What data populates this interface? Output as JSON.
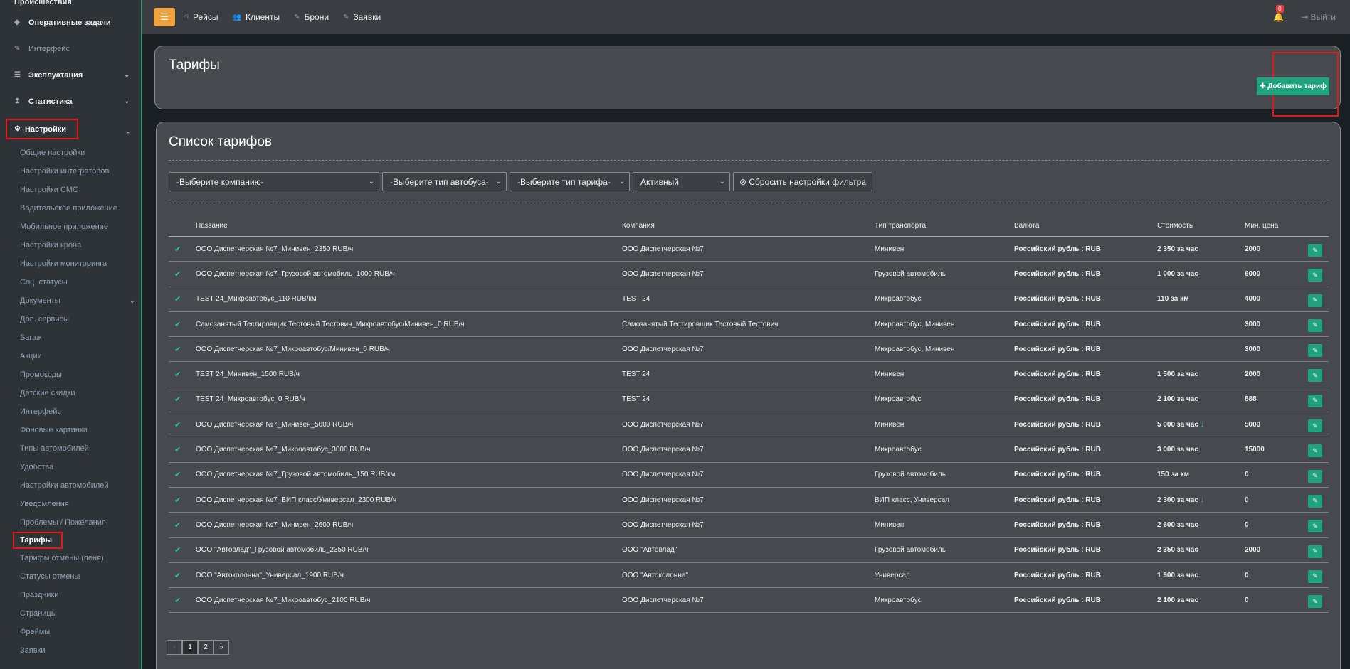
{
  "sidebar": {
    "top_item": "Происшествия",
    "items": [
      {
        "label": "Оперативные задачи"
      },
      {
        "label": "Интерфейс"
      },
      {
        "label": "Эксплуатация"
      },
      {
        "label": "Статистика"
      }
    ],
    "settings_label": "Настройки",
    "sub_items": [
      "Общие настройки",
      "Настройки интеграторов",
      "Настройки СМС",
      "Водительское приложение",
      "Мобильное приложение",
      "Настройки крона",
      "Настройки мониторинга",
      "Соц. статусы",
      "Документы",
      "Доп. сервисы",
      "Багаж",
      "Акции",
      "Промокоды",
      "Детские скидки",
      "Интерфейс",
      "Фоновые картинки",
      "Типы автомобилей",
      "Удобства",
      "Настройки автомобилей",
      "Уведомления",
      "Проблемы / Пожелания",
      "Тарифы",
      "Тарифы отмены (пеня)",
      "Статусы отмены",
      "Праздники",
      "Страницы",
      "Фреймы",
      "Заявки"
    ]
  },
  "topbar": {
    "nav": [
      "Рейсы",
      "Клиенты",
      "Брони",
      "Заявки"
    ],
    "badge": "0",
    "logout": "Выйти"
  },
  "header": {
    "title": "Тарифы",
    "add_button": "Добавить тариф"
  },
  "list": {
    "title": "Список тарифов",
    "filters": {
      "company": "-Выберите компанию-",
      "bus_type": "-Выберите тип автобуса-",
      "tariff_type": "-Выберите тип тарифа-",
      "status": "Активный",
      "reset": "Сбросить настройки фильтра"
    },
    "columns": [
      "Название",
      "Компания",
      "Тип транспорта",
      "Валюта",
      "Стоимость",
      "Мин. цена"
    ],
    "rows": [
      {
        "name": "ООО Диспетчерская №7_Минивен_2350 RUB/ч",
        "company": "ООО Диспетчерская №7",
        "transport": "Минивен",
        "currency": "Российский рубль : RUB",
        "cost": "2 350 за час",
        "min": "2000",
        "down": false
      },
      {
        "name": "ООО Диспетчерская №7_Грузовой автомобиль_1000 RUB/ч",
        "company": "ООО Диспетчерская №7",
        "transport": "Грузовой автомобиль",
        "currency": "Российский рубль : RUB",
        "cost": "1 000 за час",
        "min": "6000",
        "down": false
      },
      {
        "name": "TEST 24_Микроавтобус_110 RUB/км",
        "company": "TEST 24",
        "transport": "Микроавтобус",
        "currency": "Российский рубль : RUB",
        "cost": "110 за км",
        "min": "4000",
        "down": false
      },
      {
        "name": "Самозанятый Тестировщик Тестовый Тестович_Микроавтобус/Минивен_0 RUB/ч",
        "company": "Самозанятый Тестировщик Тестовый Тестович",
        "transport": "Микроавтобус, Минивен",
        "currency": "Российский рубль : RUB",
        "cost": "",
        "min": "3000",
        "down": false
      },
      {
        "name": "ООО Диспетчерская №7_Микроавтобус/Минивен_0 RUB/ч",
        "company": "ООО Диспетчерская №7",
        "transport": "Микроавтобус, Минивен",
        "currency": "Российский рубль : RUB",
        "cost": "",
        "min": "3000",
        "down": false
      },
      {
        "name": "TEST 24_Минивен_1500 RUB/ч",
        "company": "TEST 24",
        "transport": "Минивен",
        "currency": "Российский рубль : RUB",
        "cost": "1 500 за час",
        "min": "2000",
        "down": false
      },
      {
        "name": "TEST 24_Микроавтобус_0 RUB/ч",
        "company": "TEST 24",
        "transport": "Микроавтобус",
        "currency": "Российский рубль : RUB",
        "cost": "2 100 за час",
        "min": "888",
        "down": false
      },
      {
        "name": "ООО Диспетчерская №7_Минивен_5000 RUB/ч",
        "company": "ООО Диспетчерская №7",
        "transport": "Минивен",
        "currency": "Российский рубль : RUB",
        "cost": "5 000 за час",
        "min": "5000",
        "down": true
      },
      {
        "name": "ООО Диспетчерская №7_Микроавтобус_3000 RUB/ч",
        "company": "ООО Диспетчерская №7",
        "transport": "Микроавтобус",
        "currency": "Российский рубль : RUB",
        "cost": "3 000 за час",
        "min": "15000",
        "down": false
      },
      {
        "name": "ООО Диспетчерская №7_Грузовой автомобиль_150 RUB/км",
        "company": "ООО Диспетчерская №7",
        "transport": "Грузовой автомобиль",
        "currency": "Российский рубль : RUB",
        "cost": "150 за км",
        "min": "0",
        "down": false
      },
      {
        "name": "ООО Диспетчерская №7_ВИП класс/Универсал_2300 RUB/ч",
        "company": "ООО Диспетчерская №7",
        "transport": "ВИП класс, Универсал",
        "currency": "Российский рубль : RUB",
        "cost": "2 300 за час",
        "min": "0",
        "down": true
      },
      {
        "name": "ООО Диспетчерская №7_Минивен_2600 RUB/ч",
        "company": "ООО Диспетчерская №7",
        "transport": "Минивен",
        "currency": "Российский рубль : RUB",
        "cost": "2 600 за час",
        "min": "0",
        "down": false
      },
      {
        "name": "ООО \"Автовлад\"_Грузовой автомобиль_2350 RUB/ч",
        "company": "ООО \"Автовлад\"",
        "transport": "Грузовой автомобиль",
        "currency": "Российский рубль : RUB",
        "cost": "2 350 за час",
        "min": "2000",
        "down": false
      },
      {
        "name": "ООО \"Автоколонна\"_Универсал_1900 RUB/ч",
        "company": "ООО \"Автоколонна\"",
        "transport": "Универсал",
        "currency": "Российский рубль : RUB",
        "cost": "1 900 за час",
        "min": "0",
        "down": false
      },
      {
        "name": "ООО Диспетчерская №7_Микроавтобус_2100 RUB/ч",
        "company": "ООО Диспетчерская №7",
        "transport": "Микроавтобус",
        "currency": "Российский рубль : RUB",
        "cost": "2 100 за час",
        "min": "0",
        "down": false
      }
    ],
    "pagination": [
      "‹",
      "1",
      "2",
      "»"
    ]
  }
}
